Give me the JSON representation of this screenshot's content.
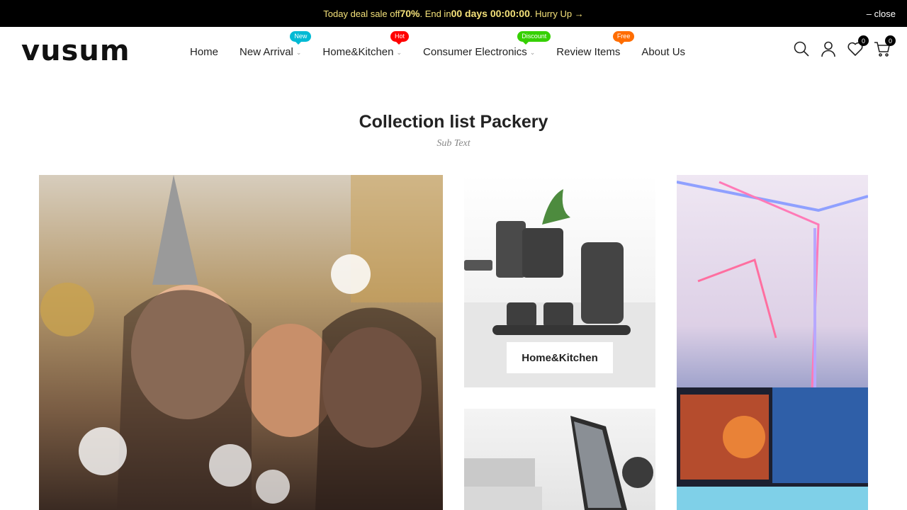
{
  "announcement": {
    "prefix": "Today deal sale off ",
    "discount": "70%",
    "middle": " . End in ",
    "countdown": "00 days 00:00:00",
    "suffix": ". Hurry Up →",
    "close_label": "– close"
  },
  "header": {
    "logo": "vusum",
    "nav": [
      {
        "label": "Home"
      },
      {
        "label": "New Arrival",
        "badge": "New",
        "badge_color": "#01bad4"
      },
      {
        "label": "Home&Kitchen",
        "badge": "Hot",
        "badge_color": "#ff0000"
      },
      {
        "label": "Consumer Electronics",
        "badge": "Discount",
        "badge_color": "#35d000"
      },
      {
        "label": "Review Items",
        "badge": "Free",
        "badge_color": "#ff6d00"
      },
      {
        "label": "About Us"
      }
    ],
    "icons": [
      "search-icon",
      "account-icon",
      "wishlist-icon",
      "cart-icon"
    ],
    "wishlist_count": "0",
    "cart_count": "0"
  },
  "collection": {
    "title": "Collection list Packery",
    "subtitle": "Sub Text",
    "tiles": [
      {
        "name": "party"
      },
      {
        "name": "kitchen",
        "label": "Home&Kitchen"
      },
      {
        "name": "laptop"
      },
      {
        "name": "gaming"
      }
    ]
  }
}
